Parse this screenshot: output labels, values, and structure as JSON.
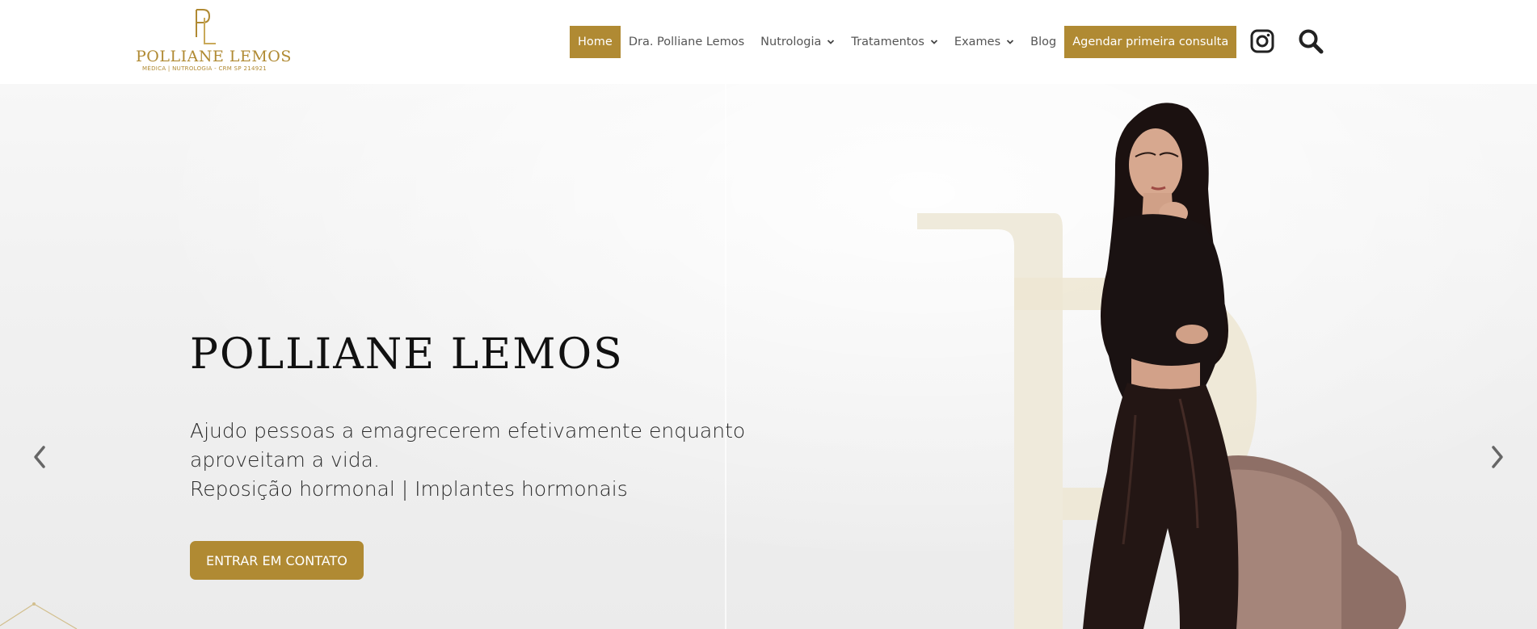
{
  "brand": {
    "name": "POLLIANE LEMOS",
    "subtitle": "MÉDICA | NUTROLOGIA - CRM SP 214921",
    "color": "#b08a33"
  },
  "nav": {
    "items": [
      {
        "label": "Home",
        "active": true,
        "dropdown": false
      },
      {
        "label": "Dra. Polliane Lemos",
        "active": false,
        "dropdown": false
      },
      {
        "label": "Nutrologia",
        "active": false,
        "dropdown": true
      },
      {
        "label": "Tratamentos",
        "active": false,
        "dropdown": true
      },
      {
        "label": "Exames",
        "active": false,
        "dropdown": true
      },
      {
        "label": "Blog",
        "active": false,
        "dropdown": false
      }
    ],
    "cta_label": "Agendar primeira consulta"
  },
  "header_icons": [
    "instagram-icon",
    "search-icon"
  ],
  "hero": {
    "title": "POLLIANE LEMOS",
    "text_line1": "Ajudo pessoas a emagrecerem efetivamente enquanto",
    "text_line2": "aproveitam a vida.",
    "text_line3": "Reposição hormonal | Implantes hormonais",
    "button_label": "ENTRAR EM CONTATO"
  },
  "slider": {
    "prev_icon": "chevron-left-icon",
    "next_icon": "chevron-right-icon"
  }
}
